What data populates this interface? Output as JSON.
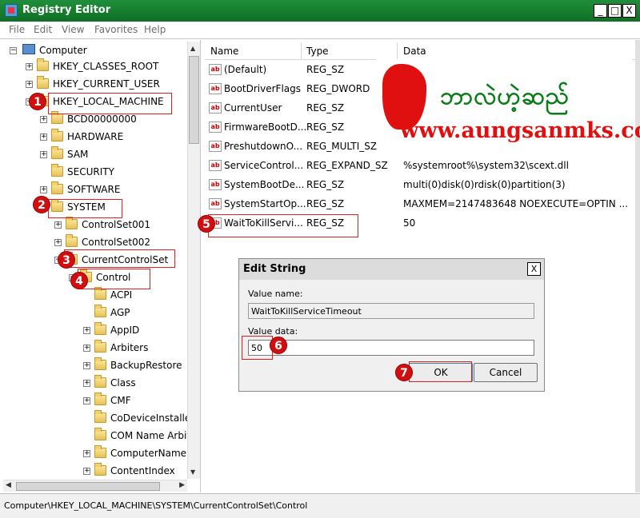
{
  "window": {
    "title": "Registry Editor",
    "min_glyph": "_",
    "max_glyph": "□",
    "close_glyph": "X"
  },
  "menu": [
    "File",
    "Edit",
    "View",
    "Favorites",
    "Help"
  ],
  "tree": {
    "root": "Computer",
    "nodes": [
      {
        "label": "HKEY_CLASSES_ROOT",
        "expander": "+"
      },
      {
        "label": "HKEY_CURRENT_USER",
        "expander": "+"
      },
      {
        "label": "HKEY_LOCAL_MACHINE",
        "expander": "−"
      },
      {
        "label": "BCD00000000",
        "expander": "+"
      },
      {
        "label": "HARDWARE",
        "expander": "+"
      },
      {
        "label": "SAM",
        "expander": "+"
      },
      {
        "label": "SECURITY",
        "expander": ""
      },
      {
        "label": "SOFTWARE",
        "expander": "+"
      },
      {
        "label": "SYSTEM",
        "expander": "−"
      },
      {
        "label": "ControlSet001",
        "expander": "+"
      },
      {
        "label": "ControlSet002",
        "expander": "+"
      },
      {
        "label": "CurrentControlSet",
        "expander": "−"
      },
      {
        "label": "Control",
        "expander": "−"
      },
      {
        "label": "ACPI",
        "expander": ""
      },
      {
        "label": "AGP",
        "expander": ""
      },
      {
        "label": "AppID",
        "expander": "+"
      },
      {
        "label": "Arbiters",
        "expander": "+"
      },
      {
        "label": "BackupRestore",
        "expander": "+"
      },
      {
        "label": "Class",
        "expander": "+"
      },
      {
        "label": "CMF",
        "expander": "+"
      },
      {
        "label": "CoDeviceInstallers",
        "expander": ""
      },
      {
        "label": "COM Name Arbiter",
        "expander": ""
      },
      {
        "label": "ComputerName",
        "expander": "+"
      },
      {
        "label": "ContentIndex",
        "expander": "+"
      }
    ]
  },
  "list": {
    "headers": {
      "name": "Name",
      "type": "Type",
      "data": "Data"
    },
    "rows": [
      {
        "name": "(Default)",
        "type": "REG_SZ",
        "data": ""
      },
      {
        "name": "BootDriverFlags",
        "type": "REG_DWORD",
        "data": ""
      },
      {
        "name": "CurrentUser",
        "type": "REG_SZ",
        "data": ""
      },
      {
        "name": "FirmwareBootD...",
        "type": "REG_SZ",
        "data": ""
      },
      {
        "name": "PreshutdownO...",
        "type": "REG_MULTI_SZ",
        "data": ""
      },
      {
        "name": "ServiceControl...",
        "type": "REG_EXPAND_SZ",
        "data": "%systemroot%\\system32\\scext.dll"
      },
      {
        "name": "SystemBootDe...",
        "type": "REG_SZ",
        "data": "multi(0)disk(0)rdisk(0)partition(3)"
      },
      {
        "name": "SystemStartOp...",
        "type": "REG_SZ",
        "data": " MAXMEM=2147483648  NOEXECUTE=OPTIN  ..."
      },
      {
        "name": "WaitToKillServi...",
        "type": "REG_SZ",
        "data": "50"
      }
    ],
    "icon_text": "ab"
  },
  "banner": {
    "burmese": "ဘာလဲဟဲ့ဆည်",
    "url": "www.aungsanmks.com"
  },
  "dialog": {
    "title": "Edit String",
    "close_glyph": "X",
    "value_name_label": "Value name:",
    "value_name": "WaitToKillServiceTimeout",
    "value_data_label": "Value data:",
    "value_data": "50",
    "ok": "OK",
    "cancel": "Cancel"
  },
  "callouts": [
    "1",
    "2",
    "3",
    "4",
    "5",
    "6",
    "7"
  ],
  "status": "Computer\\HKEY_LOCAL_MACHINE\\SYSTEM\\CurrentControlSet\\Control",
  "colors": {
    "titlebar": "#1f8f3a",
    "callout": "#d01010",
    "banner_green": "#0a7d1a",
    "banner_red": "#e01010"
  }
}
